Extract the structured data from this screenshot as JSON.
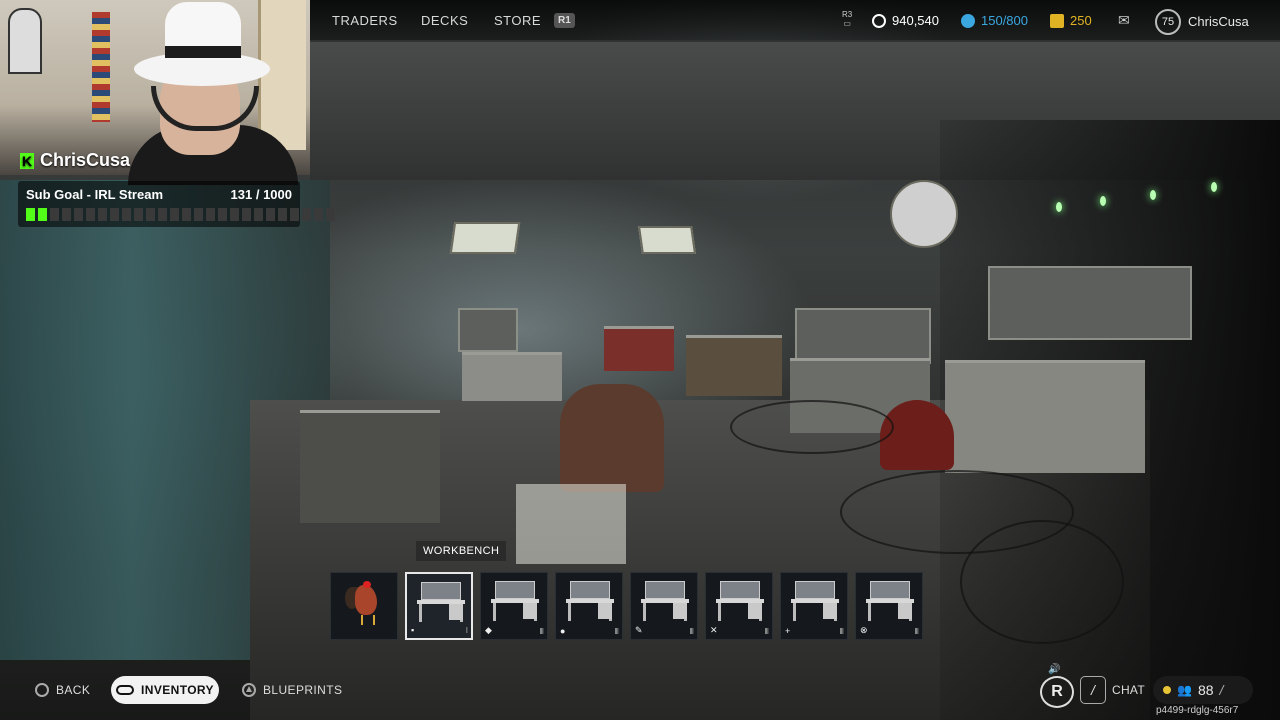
{
  "stream": {
    "streamer_name": "ChrisCusa",
    "sub_goal_label": "Sub Goal - IRL Stream",
    "sub_goal_count": "131 / 1000",
    "sub_goal_progress": 0.131
  },
  "topbar": {
    "nav": [
      {
        "label": "TRADERS"
      },
      {
        "label": "DECKS"
      },
      {
        "label": "STORE"
      }
    ],
    "store_button_hint": "R1",
    "r3_hint": "R3",
    "currency_main": "940,540",
    "capacity": "150/800",
    "tokens": "250",
    "player_level": "75",
    "username": "ChrisCusa",
    "colors": {
      "capacity": "#3ba7e0",
      "tokens": "#e0b325",
      "currency": "#ffffff"
    }
  },
  "tooltip": {
    "label": "WORKBENCH"
  },
  "hotbar": {
    "slots": [
      {
        "name": "rooster",
        "icon": "",
        "tier": ""
      },
      {
        "name": "workbench",
        "icon": "▪",
        "tier": "I",
        "selected": true
      },
      {
        "name": "gunsmith-bench",
        "icon": "◆",
        "tier": "III"
      },
      {
        "name": "medical-bench",
        "icon": "●",
        "tier": "III"
      },
      {
        "name": "utility-bench",
        "icon": "✎",
        "tier": "III"
      },
      {
        "name": "weapons-bench",
        "icon": "✕",
        "tier": "III"
      },
      {
        "name": "med-station",
        "icon": "+",
        "tier": "III"
      },
      {
        "name": "refiner",
        "icon": "⊗",
        "tier": "III"
      }
    ]
  },
  "bottom_nav": {
    "back_label": "BACK",
    "inventory_label": "INVENTORY",
    "blueprints_label": "BLUEPRINTS"
  },
  "bottom_right": {
    "chat_label": "CHAT",
    "party_count": "88",
    "session_code": "p4499-rdglg-456r7"
  }
}
